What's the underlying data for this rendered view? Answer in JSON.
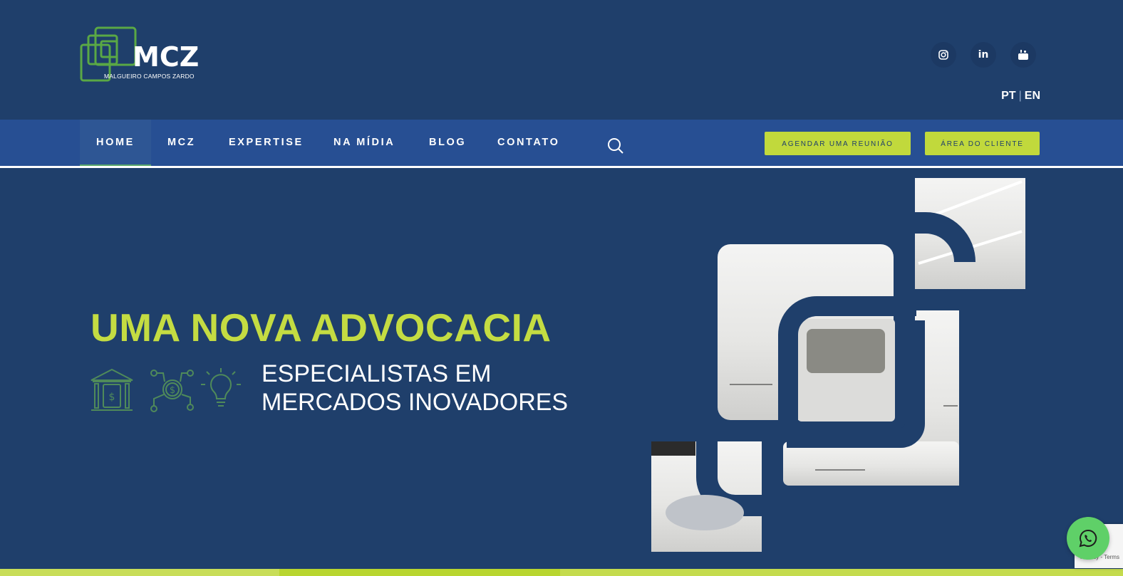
{
  "brand": {
    "logo_text": "MCZ",
    "logo_subtitle": "MALGUEIRO CAMPOS ZARDO"
  },
  "social": {
    "instagram_icon": "instagram-icon",
    "linkedin_label": "in",
    "youtube_label": "You Tube"
  },
  "language": {
    "pt": "PT",
    "separator": "|",
    "en": "EN"
  },
  "nav": {
    "items": [
      {
        "label": "HOME"
      },
      {
        "label": "MCZ"
      },
      {
        "label": "EXPERTISE"
      },
      {
        "label": "NA MÍDIA"
      },
      {
        "label": "BLOG"
      },
      {
        "label": "CONTATO"
      }
    ],
    "active_index": 0,
    "search_icon": "search-icon"
  },
  "buttons": {
    "meeting": "AGENDAR UMA REUNIÃO",
    "client_area": "ÁREA DO CLIENTE"
  },
  "hero": {
    "title": "UMA NOVA ADVOCACIA",
    "subtitle_line1": "ESPECIALISTAS EM",
    "subtitle_line2": "MERCADOS INOVADORES",
    "icons": [
      "bank-icon",
      "money-network-icon",
      "lightbulb-icon"
    ]
  },
  "widgets": {
    "whatsapp_icon": "whatsapp-icon",
    "recaptcha_text": "Privacy - Terms"
  },
  "colors": {
    "navy": "#1f3f6b",
    "nav_blue": "#274f93",
    "accent_lime": "#c1d93c",
    "logo_green": "#5aa845",
    "whatsapp_green": "#5fd068"
  }
}
